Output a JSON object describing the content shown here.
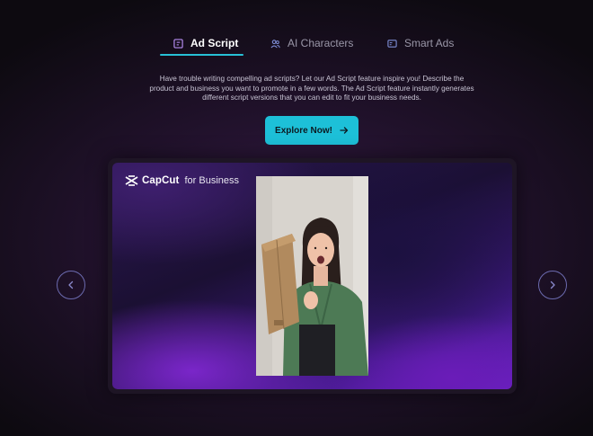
{
  "tabs": [
    {
      "label": "Ad Script",
      "active": true,
      "icon": "script-icon"
    },
    {
      "label": "AI Characters",
      "active": false,
      "icon": "characters-icon"
    },
    {
      "label": "Smart Ads",
      "active": false,
      "icon": "smart-ads-icon"
    }
  ],
  "description": "Have trouble writing compelling ad scripts? Let our Ad Script feature inspire you! Describe the product and business you want to promote in a few words. The Ad Script feature instantly generates different script versions that you can edit to fit your business needs.",
  "cta": {
    "label": "Explore Now!",
    "icon": "arrow-right-icon"
  },
  "logo": {
    "brand": "CapCut",
    "sub": "for Business"
  },
  "colors": {
    "accent": "#1dc0d8",
    "tab_underline": "#27c0d6",
    "nav_border": "#6c6bb0"
  },
  "carousel": {
    "prev_icon": "chevron-left-icon",
    "next_icon": "chevron-right-icon"
  }
}
